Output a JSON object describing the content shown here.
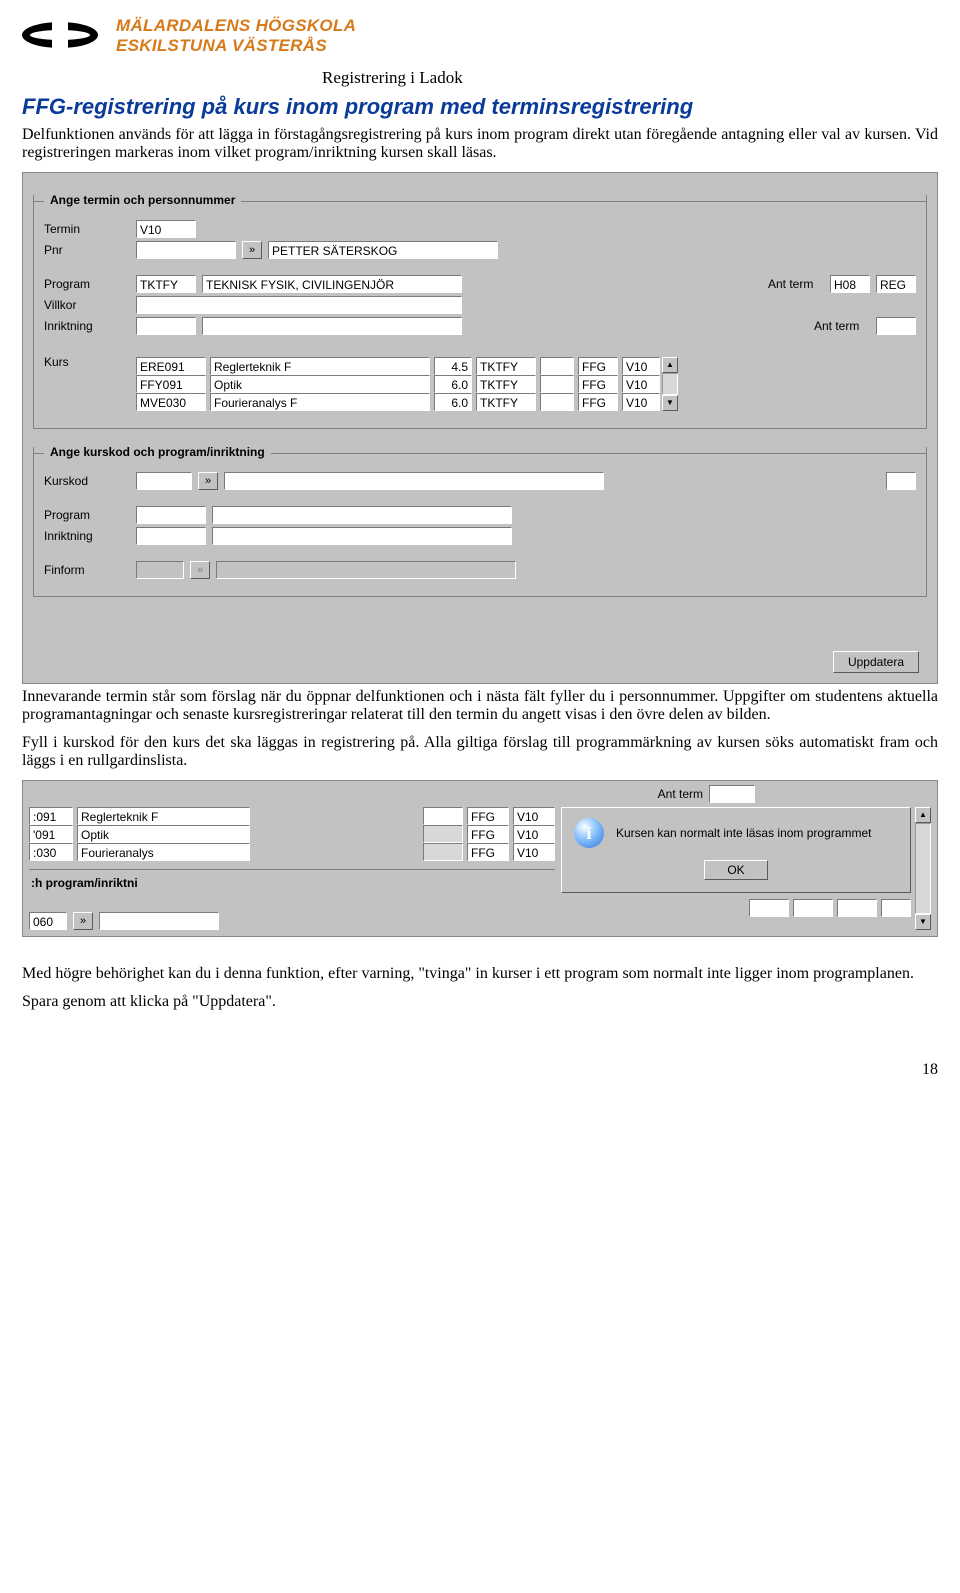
{
  "brand": {
    "line1": "MÄLARDALENS HÖGSKOLA",
    "line2": "ESKILSTUNA VÄSTERÅS"
  },
  "doc_header": "Registrering i Ladok",
  "section_title": "FFG-registrering på kurs inom program med terminsregistrering",
  "para1": "Delfunktionen används för att lägga in förstagångsregistrering på kurs inom program direkt utan föregående antagning eller val av kursen. Vid registreringen markeras inom vilket program/inriktning kursen skall läsas.",
  "panel1": {
    "group1": {
      "legend": "Ange termin och personnummer",
      "labels": {
        "termin": "Termin",
        "pnr": "Pnr",
        "program": "Program",
        "villkor": "Villkor",
        "inriktning": "Inriktning",
        "kurs": "Kurs",
        "ant_term": "Ant term"
      },
      "values": {
        "termin": "V10",
        "pnr": "",
        "pnr_name": "PETTER SÄTERSKOG",
        "program_code": "TKTFY",
        "program_name": "TEKNISK FYSIK, CIVILINGENJÖR",
        "ant_term1": "H08",
        "ant_term1_status": "REG",
        "villkor": "",
        "inriktning_code": "",
        "inriktning_name": "",
        "ant_term2": ""
      },
      "btn_expand": "»",
      "kurs_rows": [
        {
          "code": "ERE091",
          "name": "Reglerteknik F",
          "hp": "4.5",
          "prog": "TKTFY",
          "x1": "",
          "type": "FFG",
          "term": "V10"
        },
        {
          "code": "FFY091",
          "name": "Optik",
          "hp": "6.0",
          "prog": "TKTFY",
          "x1": "",
          "type": "FFG",
          "term": "V10"
        },
        {
          "code": "MVE030",
          "name": "Fourieranalys F",
          "hp": "6.0",
          "prog": "TKTFY",
          "x1": "",
          "type": "FFG",
          "term": "V10"
        }
      ],
      "scroll": {
        "up": "▲",
        "down": "▼"
      }
    },
    "group2": {
      "legend": "Ange kurskod och program/inriktning",
      "labels": {
        "kurskod": "Kurskod",
        "program": "Program",
        "inriktning": "Inriktning",
        "finform": "Finform"
      },
      "btn_expand": "»",
      "btn_expand_disabled": "»"
    },
    "footer": {
      "update": "Uppdatera"
    }
  },
  "para2": "Innevarande termin står som förslag när du öppnar delfunktionen och i nästa fält fyller du i personnummer. Uppgifter om studentens aktuella programantagningar och senaste kursregistreringar relaterat till den termin du angett visas i den övre delen av bilden.",
  "para3": "Fyll i kurskod för den kurs det ska läggas in registrering på. Alla giltiga förslag till programmärkning av kursen söks automatiskt fram och läggs i en rullgardinslista.",
  "panel2": {
    "ant_term_label": "Ant term",
    "rows": [
      {
        "code": ":091",
        "name": "Reglerteknik F",
        "type": "FFG",
        "term": "V10"
      },
      {
        "code": "'091",
        "name": "Optik",
        "type": "FFG",
        "term": "V10"
      },
      {
        "code": ":030",
        "name": "Fourieranalys",
        "type": "FFG",
        "term": "V10"
      }
    ],
    "scroll": {
      "up": "▲",
      "down": "▼"
    },
    "dialog": {
      "message": "Kursen kan normalt inte läsas inom programmet",
      "ok": "OK"
    },
    "group_legend": ":h program/inriktni",
    "bottom_code": "060",
    "btn_expand": "»"
  },
  "para4": "Med högre behörighet kan du i denna funktion, efter varning, \"tvinga\" in kurser i ett program som normalt inte ligger inom programplanen.",
  "para5": "Spara genom att klicka på \"Uppdatera\".",
  "page_number": "18"
}
